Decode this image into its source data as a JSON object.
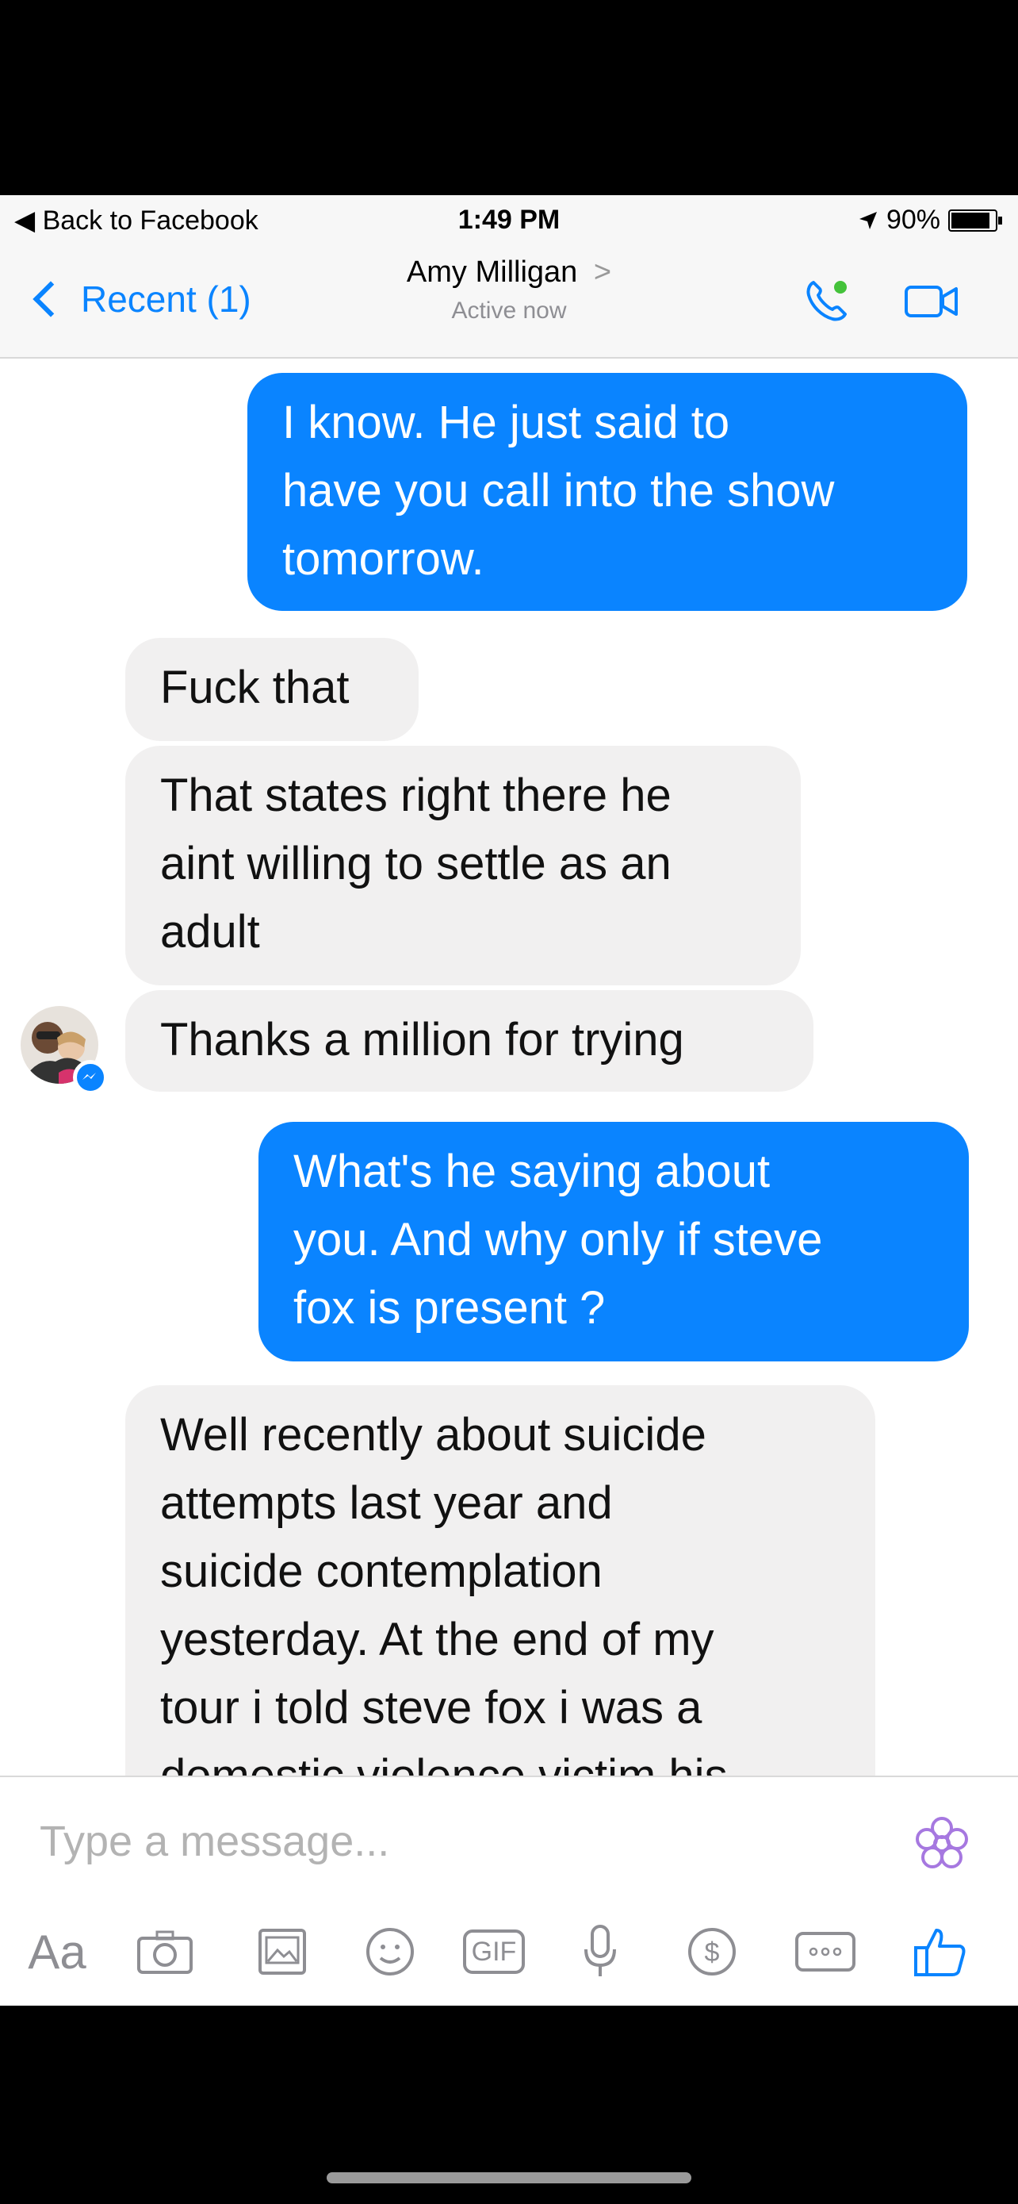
{
  "status_bar": {
    "back_label": "◀ Back to Facebook",
    "time": "1:49 PM",
    "battery": "90%"
  },
  "header": {
    "back_label": "Recent (1)",
    "contact_name": "Amy Milligan",
    "name_chevron": ">",
    "status": "Active now"
  },
  "messages": [
    {
      "sender": "me",
      "text": "I know.    He just said to\nhave you call into the show\ntomorrow."
    },
    {
      "sender": "them",
      "text": "Fuck that"
    },
    {
      "sender": "them",
      "text": "That states right there he\naint willing to settle as an\nadult"
    },
    {
      "sender": "them",
      "text": "Thanks a million for trying"
    },
    {
      "sender": "me",
      "text": "What's he saying about\nyou.  And why only if steve\nfox is present ?"
    },
    {
      "sender": "them",
      "text": "Well recently about suicide\nattempts last year and\nsuicide contemplation\nyesterday. At the end of my\ntour i told steve fox i was a\ndomestic violence victim his"
    }
  ],
  "composer": {
    "placeholder": "Type a message...",
    "tools": {
      "aa": "Aa",
      "gif": "GIF"
    }
  },
  "icons": [
    "phone-icon",
    "video-camera-icon",
    "flower-icon",
    "camera-icon",
    "gallery-icon",
    "emoji-icon",
    "gif-icon",
    "microphone-icon",
    "payment-icon",
    "more-icon",
    "like-icon"
  ],
  "colors": {
    "accent": "#0a84ff",
    "incoming_bubble": "#f1f0f0",
    "active_dot": "#44c23a",
    "emoji_purple": "#a678e0"
  }
}
